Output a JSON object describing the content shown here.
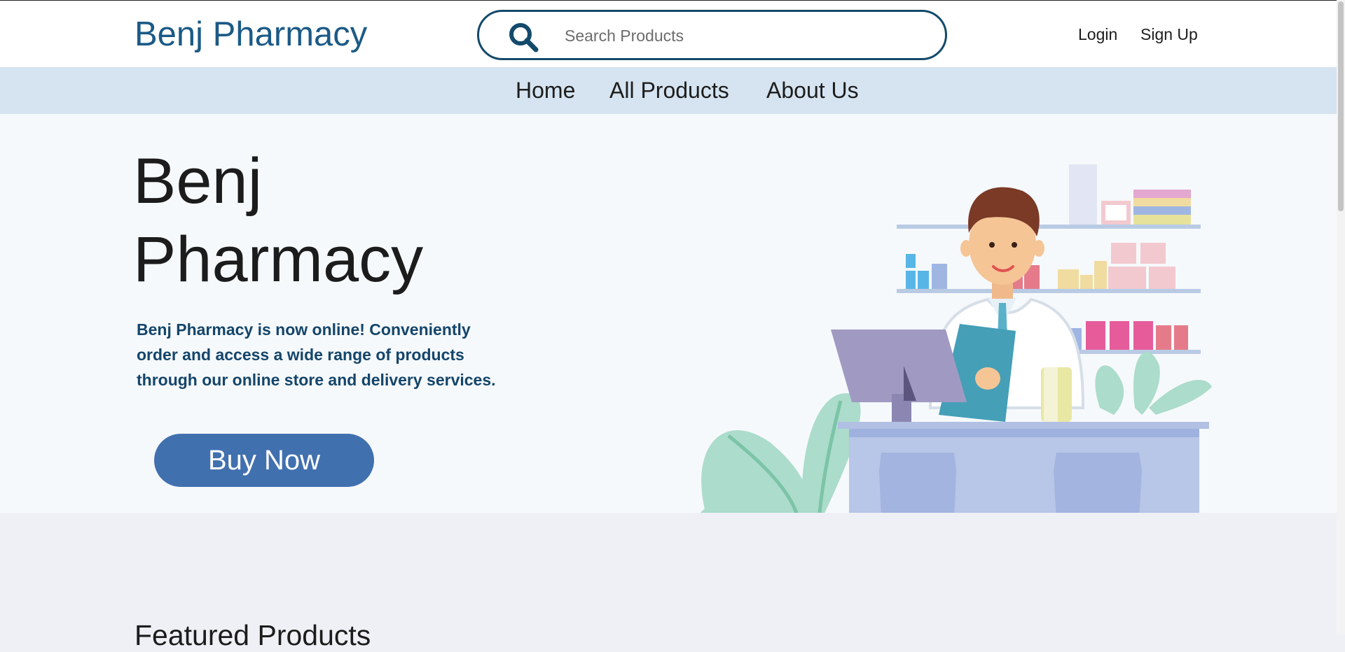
{
  "header": {
    "brand": "Benj Pharmacy",
    "search": {
      "placeholder": "Search Products",
      "value": ""
    },
    "login_label": "Login",
    "signup_label": "Sign Up"
  },
  "nav": {
    "items": [
      {
        "label": "Home"
      },
      {
        "label": "All Products"
      },
      {
        "label": "About Us"
      }
    ]
  },
  "hero": {
    "title": "Benj Pharmacy",
    "description": "Benj Pharmacy is now online! Conveniently order and access a wide range of products through our online store and delivery services.",
    "button_label": "Buy Now"
  },
  "featured": {
    "title": "Featured Products"
  },
  "icons": {
    "search": "search-icon"
  },
  "colors": {
    "brand": "#1b5a86",
    "nav_bg": "#d5e4f0",
    "hero_bg": "#f6f9fb",
    "button": "#4170af",
    "page_bg": "#eef0f5"
  }
}
